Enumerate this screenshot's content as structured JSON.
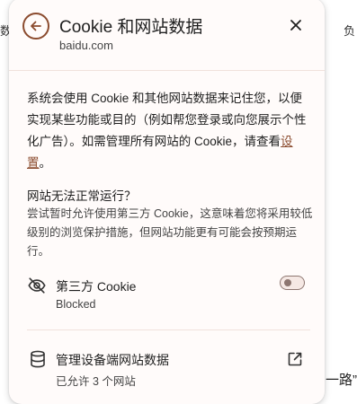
{
  "background": {
    "left_fragment": "数",
    "right_fragment": "负",
    "bottom_fragment": "一路”"
  },
  "header": {
    "title": "Cookie 和网站数据",
    "site": "baidu.com",
    "back_icon": "arrow-left-circle-icon",
    "close_icon": "close-icon"
  },
  "description": {
    "text_before_link": "系统会使用 Cookie 和其他网站数据来记住您，以便实现某些功能或目的（例如帮您登录或向您展示个性化广告）。如需管理所有网站的 Cookie，请查看",
    "link_text": "设置",
    "text_after_link": "。"
  },
  "site_problem": {
    "title": "网站无法正常运行？",
    "body": "尝试暂时允许使用第三方 Cookie，这意味着您将采用较低级别的浏览保护措施，但网站功能更有可能会按预期运行。"
  },
  "third_party_cookie": {
    "label": "第三方 Cookie",
    "status": "Blocked",
    "icon": "eye-off-icon",
    "toggle_on": false
  },
  "manage_data": {
    "label": "管理设备端网站数据",
    "sub": "已允许 3 个网站",
    "icon": "database-icon",
    "action_icon": "open-in-new-icon"
  },
  "colors": {
    "accent": "#8b4b2e",
    "panel_bg": "#fffbfa",
    "divider": "#f1e2dc"
  }
}
